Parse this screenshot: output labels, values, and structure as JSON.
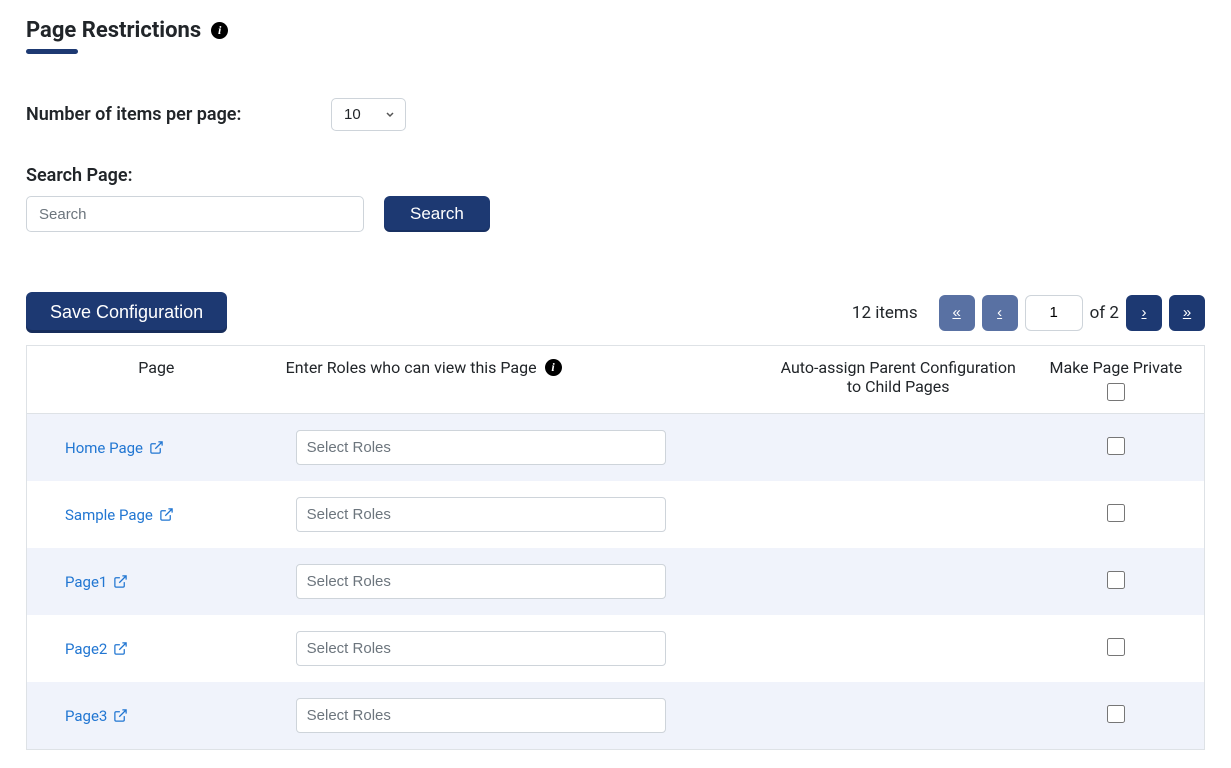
{
  "header": {
    "title": "Page Restrictions"
  },
  "controls": {
    "perPageLabel": "Number of items per page:",
    "perPageValue": "10",
    "searchLabel": "Search Page:",
    "searchPlaceholder": "Search",
    "searchButton": "Search"
  },
  "actions": {
    "saveButton": "Save Configuration"
  },
  "pagination": {
    "itemsText": "12 items",
    "currentPage": "1",
    "ofText": "of 2"
  },
  "table": {
    "headers": {
      "page": "Page",
      "roles": "Enter Roles who can view this Page",
      "autoAssign": "Auto-assign Parent Configuration to Child Pages",
      "makePrivate": "Make Page Private"
    },
    "rolesPlaceholder": "Select Roles",
    "rows": [
      {
        "name": "Home Page"
      },
      {
        "name": "Sample Page"
      },
      {
        "name": "Page1"
      },
      {
        "name": "Page2"
      },
      {
        "name": "Page3"
      }
    ]
  }
}
